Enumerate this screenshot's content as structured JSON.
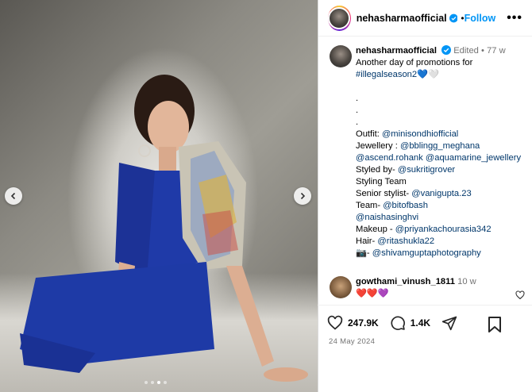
{
  "post": {
    "username": "nehasharmaofficial",
    "follow_label": "Follow",
    "more_label": "•••"
  },
  "caption": {
    "username": "nehasharmaofficial",
    "edited": "Edited",
    "separator": "•",
    "time": "77 w",
    "line1": "Another day of promotions for",
    "hashtag": "#illegalseason2",
    "emojis": "💙🤍",
    "dot1": ".",
    "dot2": ".",
    "dot3": ".",
    "outfit_label": "Outfit: ",
    "outfit_link": "@minisondhiofficial",
    "jewellery_label": "Jewellery : ",
    "jewellery_link1": "@bblingg_meghana",
    "jewellery_link2": "@ascend.rohank",
    "jewellery_link3": "@aquamarine_jewellery",
    "styled_label": "Styled by- ",
    "styled_link": "@sukritigrover",
    "styling_team": "Styling Team",
    "senior_label": "Senior stylist- ",
    "senior_link": "@vanigupta.23",
    "team_label": "Team- ",
    "team_link1": "@bitofbash",
    "team_link2": "@naishasinghvi",
    "makeup_label": "Makeup - ",
    "makeup_link": "@priyankachourasia342",
    "hair_label": "Hair- ",
    "hair_link": "@ritashukla22",
    "camera_emoji": "📷- ",
    "photo_link": "@shivamguptaphotography"
  },
  "comment": {
    "username": "gowthami_vinush_1811",
    "time": "10 w",
    "emojis": "❤️❤️💜"
  },
  "actions": {
    "likes": "247.9K",
    "comments": "1.4K",
    "date": "24 May 2024"
  },
  "colors": {
    "link": "#00376b",
    "follow": "#0095f6",
    "muted": "#737373",
    "verified": "#0095f6",
    "suit_blue": "#1f3aa8"
  },
  "icons": {
    "prev": "chevron-left-icon",
    "next": "chevron-right-icon",
    "like": "heart-icon",
    "comment": "comment-icon",
    "share": "share-icon",
    "save": "bookmark-icon",
    "verified": "verified-badge-icon"
  },
  "carousel": {
    "total": 4,
    "active": 3
  }
}
